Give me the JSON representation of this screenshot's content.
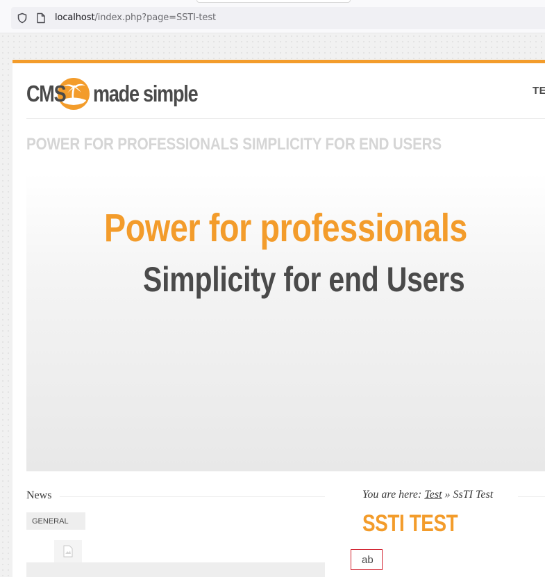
{
  "browser": {
    "url_host": "localhost",
    "url_path": "/index.php?page=SSTI-test"
  },
  "site": {
    "logo": {
      "word_left": "CMS",
      "word_right": "made simple"
    },
    "nav_item_partial": "TES",
    "tagline": "POWER FOR PROFESSIONALS SIMPLICITY FOR END USERS",
    "banner": {
      "line1": "Power for professionals",
      "line2": "Simplicity for end Users"
    },
    "accent_color": "#f39c2b",
    "text_color": "#4a4a4a"
  },
  "sidebar": {
    "news_heading": "News",
    "category_tab": "GENERAL",
    "thumbnail_icon": "broken-image-icon"
  },
  "content": {
    "breadcrumb": {
      "prefix": "You are here:",
      "link": "Test",
      "separator": "»",
      "current": "SsTI Test"
    },
    "heading": "SSTI TEST",
    "output_value": "ab",
    "highlight_color": "#d01e2c"
  }
}
